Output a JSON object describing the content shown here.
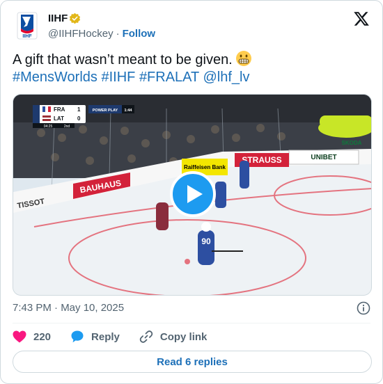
{
  "author": {
    "display_name": "IIHF",
    "handle": "@IIHFHockey",
    "separator": "·",
    "follow_label": "Follow",
    "verified": true,
    "avatar_text": "IIHF"
  },
  "tweet": {
    "text": "A gift that wasn’t meant to be given.",
    "emoji": "grimacing-face",
    "links": [
      "#MensWorlds",
      "#IIHF",
      "#FRALAT",
      "@lhf_lv"
    ]
  },
  "video": {
    "scoreboard": {
      "team1": "FRA",
      "score1": "1",
      "team2": "LAT",
      "score2": "0",
      "situation": "POWER PLAY",
      "pp_time": "1:44",
      "period_time": "04:25",
      "period": "2nd"
    },
    "ads": [
      "BAUHAUS",
      "TISSOT",
      "Raiffeisen Bank",
      "STRAUSS",
      "UNIBET",
      "UNIBET",
      "SKODA"
    ],
    "player_number": "90"
  },
  "meta": {
    "timestamp": "7:43 PM · May 10, 2025"
  },
  "actions": {
    "likes": "220",
    "reply_label": "Reply",
    "copy_label": "Copy link"
  },
  "replies_button": "Read 6 replies",
  "colors": {
    "link": "#1d70b8",
    "like": "#f91880",
    "play": "#1d9bf0",
    "reply": "#1d9bf0"
  }
}
